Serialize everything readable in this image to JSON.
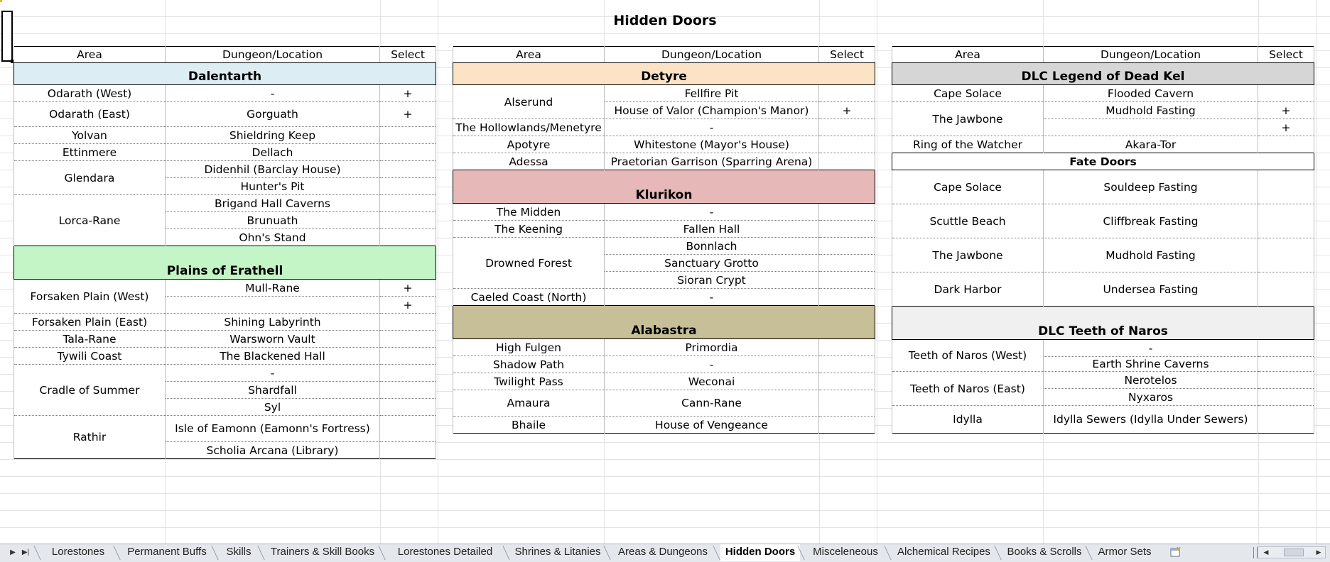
{
  "sheet_title": "Hidden Doors",
  "blocks": [
    {
      "header": [
        "Area",
        "Dungeon/Location",
        "Select"
      ],
      "sections": [
        {
          "name": "Dalentarth",
          "color": "#dcedf3",
          "rows": [
            {
              "area": "Odarath (West)",
              "locations": [
                {
                  "name": "-",
                  "select": "+"
                }
              ]
            },
            {
              "area": "Odarath (East)",
              "locations": [
                {
                  "name": "Gorguath",
                  "select": "+"
                }
              ]
            },
            {
              "area": "Yolvan",
              "locations": [
                {
                  "name": "Shieldring Keep",
                  "select": ""
                }
              ]
            },
            {
              "area": "Ettinmere",
              "locations": [
                {
                  "name": "Dellach",
                  "select": ""
                }
              ]
            },
            {
              "area": "Glendara",
              "locations": [
                {
                  "name": "Didenhil (Barclay House)",
                  "select": ""
                },
                {
                  "name": "Hunter's Pit",
                  "select": ""
                }
              ]
            },
            {
              "area": "Lorca-Rane",
              "locations": [
                {
                  "name": "Brigand Hall Caverns",
                  "select": ""
                },
                {
                  "name": "Brunuath",
                  "select": ""
                },
                {
                  "name": "Ohn's Stand",
                  "select": ""
                }
              ]
            }
          ]
        },
        {
          "name": "Plains of Erathell",
          "color": "#c4f5c6",
          "rows": [
            {
              "area": "Forsaken Plain (West)",
              "locations": [
                {
                  "name": "Mull-Rane",
                  "select": "+"
                },
                {
                  "name": "",
                  "select": "+"
                }
              ]
            },
            {
              "area": "Forsaken Plain (East)",
              "locations": [
                {
                  "name": "Shining Labyrinth",
                  "select": ""
                }
              ]
            },
            {
              "area": "Tala-Rane",
              "locations": [
                {
                  "name": "Warsworn Vault",
                  "select": ""
                }
              ]
            },
            {
              "area": "Tywili Coast",
              "locations": [
                {
                  "name": "The Blackened Hall",
                  "select": ""
                }
              ]
            },
            {
              "area": "Cradle of Summer",
              "locations": [
                {
                  "name": "-",
                  "select": ""
                },
                {
                  "name": "Shardfall",
                  "select": ""
                },
                {
                  "name": "Syl",
                  "select": ""
                }
              ]
            },
            {
              "area": "Rathir",
              "locations": [
                {
                  "name": "Isle of Eamonn (Eamonn's Fortress)",
                  "select": ""
                },
                {
                  "name": "Scholia Arcana (Library)",
                  "select": ""
                }
              ]
            }
          ]
        }
      ]
    },
    {
      "header": [
        "Area",
        "Dungeon/Location",
        "Select"
      ],
      "sections": [
        {
          "name": "Detyre",
          "color": "#fde3c5",
          "rows": [
            {
              "area": "Alserund",
              "locations": [
                {
                  "name": "Fellfire Pit",
                  "select": ""
                },
                {
                  "name": "House of Valor (Champion's Manor)",
                  "select": "+"
                }
              ]
            },
            {
              "area": "The Hollowlands/Menetyre",
              "locations": [
                {
                  "name": "-",
                  "select": ""
                }
              ]
            },
            {
              "area": "Apotyre",
              "locations": [
                {
                  "name": "Whitestone (Mayor's House)",
                  "select": ""
                }
              ]
            },
            {
              "area": "Adessa",
              "locations": [
                {
                  "name": "Praetorian Garrison (Sparring Arena)",
                  "select": ""
                }
              ]
            }
          ]
        },
        {
          "name": "Klurikon",
          "color": "#e7b8b8",
          "rows": [
            {
              "area": "The Midden",
              "locations": [
                {
                  "name": "-",
                  "select": ""
                }
              ]
            },
            {
              "area": "The Keening",
              "locations": [
                {
                  "name": "Fallen Hall",
                  "select": ""
                }
              ]
            },
            {
              "area": "Drowned Forest",
              "locations": [
                {
                  "name": "Bonnlach",
                  "select": ""
                },
                {
                  "name": "Sanctuary Grotto",
                  "select": ""
                },
                {
                  "name": "Sioran Crypt",
                  "select": ""
                }
              ]
            },
            {
              "area": "Caeled Coast (North)",
              "locations": [
                {
                  "name": "-",
                  "select": ""
                }
              ]
            }
          ]
        },
        {
          "name": "Alabastra",
          "color": "#c7bf98",
          "rows": [
            {
              "area": "High Fulgen",
              "locations": [
                {
                  "name": "Primordia",
                  "select": ""
                }
              ]
            },
            {
              "area": "Shadow Path",
              "locations": [
                {
                  "name": "-",
                  "select": ""
                }
              ]
            },
            {
              "area": "Twilight Pass",
              "locations": [
                {
                  "name": "Weconai",
                  "select": ""
                }
              ]
            },
            {
              "area": "Amaura",
              "locations": [
                {
                  "name": "Cann-Rane",
                  "select": ""
                }
              ]
            },
            {
              "area": "Bhaile",
              "locations": [
                {
                  "name": "House of Vengeance",
                  "select": ""
                }
              ]
            }
          ]
        }
      ]
    },
    {
      "header": [
        "Area",
        "Dungeon/Location",
        "Select"
      ],
      "sections": [
        {
          "name": "DLC  Legend of Dead Kel",
          "color": "#d6d6d6",
          "rows": [
            {
              "area": "Cape Solace",
              "locations": [
                {
                  "name": "Flooded Cavern",
                  "select": ""
                }
              ]
            },
            {
              "area": "The Jawbone",
              "locations": [
                {
                  "name": "Mudhold Fasting",
                  "select": "+"
                },
                {
                  "name": "",
                  "select": "+"
                }
              ]
            },
            {
              "area": "Ring of the Watcher",
              "locations": [
                {
                  "name": "Akara-Tor",
                  "select": ""
                }
              ]
            }
          ]
        },
        {
          "name": "Fate Doors",
          "color": "#ffffff",
          "rows": [
            {
              "area": "Cape Solace",
              "locations": [
                {
                  "name": "Souldeep Fasting",
                  "select": ""
                }
              ]
            },
            {
              "area": "Scuttle Beach",
              "locations": [
                {
                  "name": "Cliffbreak Fasting",
                  "select": ""
                }
              ]
            },
            {
              "area": "The Jawbone",
              "locations": [
                {
                  "name": "Mudhold Fasting",
                  "select": ""
                }
              ]
            },
            {
              "area": "Dark Harbor",
              "locations": [
                {
                  "name": "Undersea Fasting",
                  "select": ""
                }
              ]
            }
          ]
        },
        {
          "name": "DLC  Teeth of Naros",
          "color": "#f0f0f0",
          "rows": [
            {
              "area": "Teeth of Naros (West)",
              "locations": [
                {
                  "name": "-",
                  "select": ""
                },
                {
                  "name": "Earth Shrine Caverns",
                  "select": ""
                }
              ]
            },
            {
              "area": "Teeth of Naros (East)",
              "locations": [
                {
                  "name": "Nerotelos",
                  "select": ""
                },
                {
                  "name": "Nyxaros",
                  "select": ""
                }
              ]
            },
            {
              "area": "Idylla",
              "locations": [
                {
                  "name": "Idylla Sewers (Idylla Under Sewers)",
                  "select": ""
                }
              ]
            }
          ]
        }
      ]
    }
  ],
  "sheet_tabs": [
    {
      "label": "Lorestones",
      "active": false
    },
    {
      "label": "Permanent Buffs",
      "active": false
    },
    {
      "label": "Skills",
      "active": false
    },
    {
      "label": "Trainers & Skill Books",
      "active": false
    },
    {
      "label": "Lorestones Detailed",
      "active": false
    },
    {
      "label": "Shrines & Litanies",
      "active": false
    },
    {
      "label": "Areas & Dungeons",
      "active": false
    },
    {
      "label": "Hidden Doors",
      "active": true
    },
    {
      "label": "Misceleneous",
      "active": false
    },
    {
      "label": "Alchemical Recipes",
      "active": false
    },
    {
      "label": "Books & Scrolls",
      "active": false
    },
    {
      "label": "Armor Sets",
      "active": false
    }
  ],
  "nav_buttons": [
    "first-sheet-icon",
    "last-sheet-icon"
  ],
  "new_sheet_icon": "insert-worksheet-icon"
}
